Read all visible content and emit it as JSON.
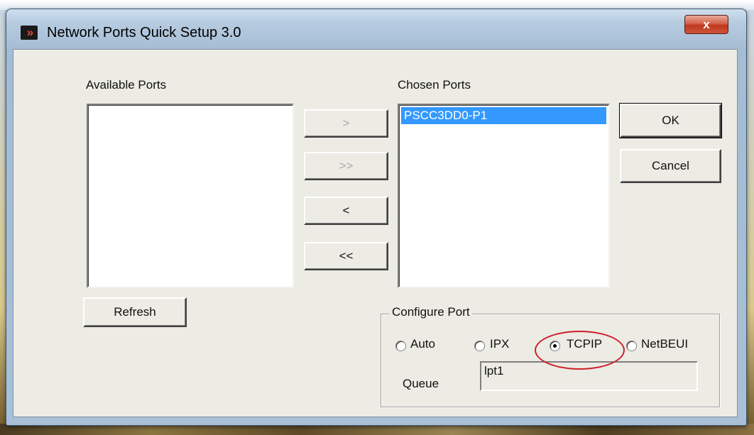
{
  "window": {
    "title": "Network Ports Quick Setup 3.0",
    "close_glyph": "x",
    "app_icon_glyph": "»",
    "icon": "app-double-chevron-icon"
  },
  "available": {
    "label": "Available Ports",
    "items": []
  },
  "chosen": {
    "label": "Chosen Ports",
    "items": [
      "PSCC3DD0-P1"
    ]
  },
  "transfer": {
    "add_one": ">",
    "add_all": ">>",
    "remove_one": "<",
    "remove_all": "<<"
  },
  "actions": {
    "ok": "OK",
    "cancel": "Cancel",
    "refresh": "Refresh"
  },
  "configure": {
    "title": "Configure Port",
    "options": [
      "Auto",
      "IPX",
      "TCPIP",
      "NetBEUI"
    ],
    "selected": "TCPIP",
    "queue_label": "Queue",
    "queue_value": "lpt1"
  },
  "colors": {
    "selection": "#3399ff",
    "annotation": "#cc1f2a",
    "close_button": "#c0391f"
  }
}
